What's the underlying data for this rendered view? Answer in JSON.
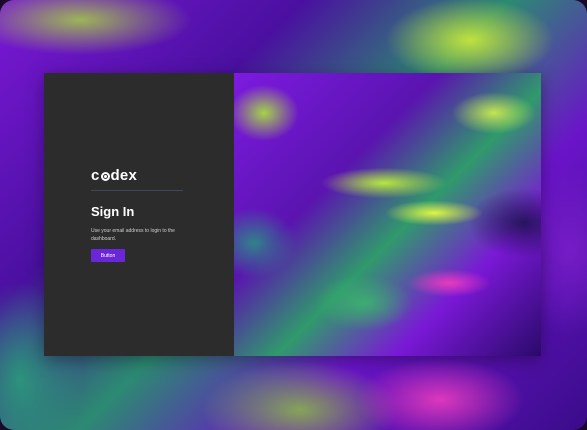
{
  "brand": {
    "name_prefix": "c",
    "name_suffix": "dex"
  },
  "signin": {
    "title": "Sign In",
    "description": "Use your email address to login to the dashboard.",
    "button_label": "Button"
  },
  "colors": {
    "panel_bg": "#2c2c2c",
    "accent": "#6a26d8",
    "divider": "#3e4a58"
  }
}
